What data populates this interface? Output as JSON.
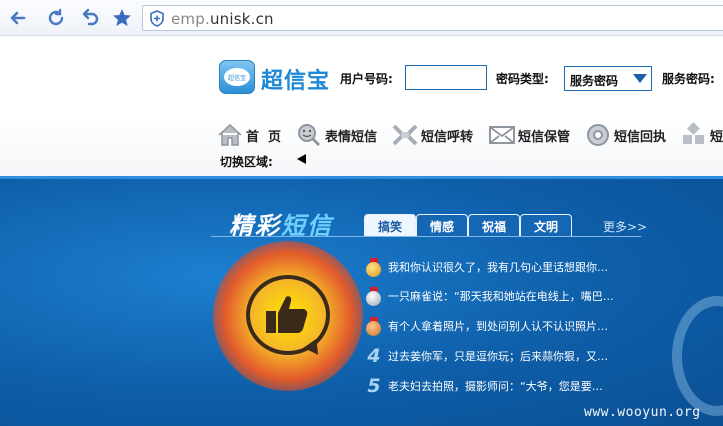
{
  "browser": {
    "url_prefix": "emp.",
    "url_domain": "unisk.cn",
    "icons": [
      "back-arrow-icon",
      "refresh-icon",
      "undo-icon",
      "star-icon",
      "shield-icon"
    ]
  },
  "header": {
    "logo_icon_text": "超信宝",
    "logo_text": "超信宝",
    "user_label": "用户号码:",
    "user_value": "",
    "pwd_type_label": "密码类型:",
    "pwd_type_value": "服务密码",
    "service_pwd_label": "服务密码:"
  },
  "menu": {
    "items": [
      {
        "label": "首  页",
        "icon": "home-icon"
      },
      {
        "label": "表情短信",
        "icon": "smiley-search-icon"
      },
      {
        "label": "短信呼转",
        "icon": "forward-icon"
      },
      {
        "label": "短信保管",
        "icon": "envelope-icon"
      },
      {
        "label": "短信回执",
        "icon": "receipt-icon"
      },
      {
        "label": "短",
        "icon": "more-icon"
      }
    ],
    "region_label": "切换区域:"
  },
  "section": {
    "title_part1": "精彩",
    "title_part2": "短信",
    "tabs": [
      "搞笑",
      "情感",
      "祝福",
      "文明"
    ],
    "active_tab": "搞笑",
    "more": "更多>>",
    "list": [
      {
        "rank": "1",
        "text": "我和你认识很久了，我有几句心里话想跟你…"
      },
      {
        "rank": "2",
        "text": "一只麻雀说：“那天我和她站在电线上，嘴巴…"
      },
      {
        "rank": "3",
        "text": "有个人拿着照片，到处问别人认不认识照片…"
      },
      {
        "rank": "4",
        "text": "过去姜你军，只是逗你玩；后来蒜你狠，又…"
      },
      {
        "rank": "5",
        "text": "老夫妇去拍照，摄影师问：“大爷，您是要…"
      }
    ],
    "watermark": "www.wooyun.org"
  }
}
